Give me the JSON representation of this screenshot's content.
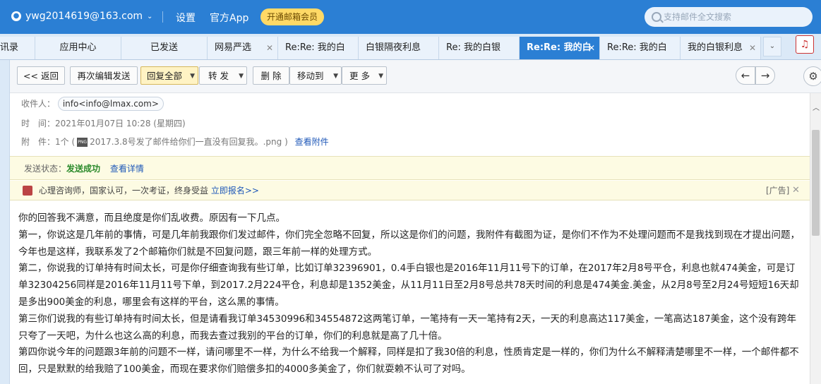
{
  "topbar": {
    "account": "ywg2014619@163.com",
    "settings": "设置",
    "app": "官方App",
    "vip": "开通邮箱会员",
    "search_placeholder": "支持邮件全文搜索"
  },
  "tabs": [
    {
      "label": "讯录"
    },
    {
      "label": "应用中心"
    },
    {
      "label": "已发送"
    },
    {
      "label": "网易严选"
    },
    {
      "label": "Re:Re: 我的白"
    },
    {
      "label": "白银隔夜利息"
    },
    {
      "label": "Re: 我的白银"
    },
    {
      "label": "Re:Re: 我的白"
    },
    {
      "label": "Re:Re: 我的白"
    },
    {
      "label": "我的白银利息"
    }
  ],
  "toolbar": {
    "back": "<< 返回",
    "reedit": "再次编辑发送",
    "reply_all": "回复全部",
    "forward": "转 发",
    "delete": "删 除",
    "move_to": "移动到",
    "more": "更 多"
  },
  "header": {
    "to_label": "收件人：",
    "to_value": "info<info@lmax.com>",
    "time_label": "时　间：",
    "time_value": "2021年01月07日 10:28 (星期四)",
    "attach_label": "附　件：",
    "attach_count": "1个 (",
    "attach_name": "2017.3.8号发了邮件给你们一直没有回复我。.png )",
    "attach_link": "查看附件"
  },
  "status": {
    "label": "发送状态：",
    "value": "发送成功",
    "detail_link": "查看详情"
  },
  "ad": {
    "text": "心理咨询师，国家认可，一次考证，终身受益",
    "link": "立即报名>>",
    "tag": "[广告]",
    "close": "✕"
  },
  "body": [
    "你的回答我不满意，而且绝度是你们乱收费。原因有一下几点。",
    "第一，你说这是几年前的事情，可是几年前我跟你们发过邮件，你们完全忽略不回复，所以这是你们的问题，我附件有截图为证，是你们不作为不处理问题而不是我找到现在才提出问题，今年也是这样，我联系发了2个邮箱你们就是不回复问题，跟三年前一样的处理方式。",
    "第二，你说我的订单持有时间太长，可是你仔细查询我有些订单，比如订单32396901，0.4手白银也是2016年11月11号下的订单，在2017年2月8号平仓，利息也就474美金，可是订单32304256同样是2016年11月11号下单，到2017.2月224平仓，利息却是1352美金，从11月11日至2月8号总共78天时间的利息是474美金.美金，从2月8号至2月24号短短16天却是多出900美金的利息，哪里会有这样的平台，这么黑的事情。",
    "第三你们说我的有些订单持有时间太长，但是请看我订单34530996和34554872这两笔订单，一笔持有一天一笔持有2天，一天的利息高达117美金，一笔高达187美金，这个没有跨年只夸了一天吧，为什么也这么高的利息，而我去查过我别的平台的订单，你们的利息就是高了几十倍。",
    "第四你说今年的问题跟3年前的问题不一样，请问哪里不一样，为什么不给我一个解释，同样是扣了我30倍的利息，性质肯定是一样的，你们为什么不解释清楚哪里不一样，一个邮件都不回，只是默默的给我赔了100美金，而现在要求你们赔偿多扣的4000多美金了，你们就耍赖不认可了对吗。"
  ]
}
